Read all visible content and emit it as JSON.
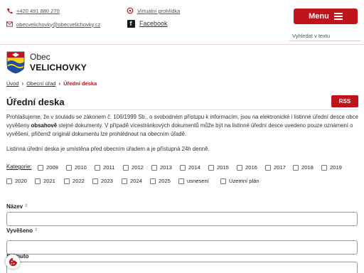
{
  "header": {
    "phone": "+420 491 880 270",
    "email": "obecvelichovky@obecvelichovky.cz",
    "virtual_tour": "Virtuální prohlídka",
    "facebook": "Facebook",
    "menu_label": "Menu",
    "search_placeholder": "Vyhledat v textu"
  },
  "logo": {
    "line1": "Obec",
    "line2": "VELICHOVKY"
  },
  "breadcrumb": {
    "items": [
      "Úvod",
      "Obecní úřad"
    ],
    "current": "Úřední deska"
  },
  "page": {
    "title": "Úřední deska",
    "rss_label": "RSS",
    "intro_part1": "Prohlašujeme, že v souladu se zákonem č. 106/1999 Sb., o svobodném přístupu k informacím, jsou na elektronické i listinné úřední desce obce vyvěšeny ",
    "intro_bold": "obsahově",
    "intro_part2": " stejné dokumenty. V případě vícestránkových dokumentů může být na listinné úřední desce uvedeno pouze oznámení o vyvěšení, přičemž originál dokumentu lze prohlédnout na obecním úřadě.",
    "intro_note": "Listinná úřední deska je umístěna před obecním úřadem a je přístupná 24h denně."
  },
  "categories": {
    "label": "Kategorie:",
    "row1": [
      "2009",
      "2010",
      "2011",
      "2012",
      "2013",
      "2014",
      "2015",
      "2016",
      "2017",
      "2018",
      "2019"
    ],
    "row2": [
      "2020",
      "2021",
      "2022",
      "2023",
      "2024",
      "2025",
      "usnesení",
      "Územní plán"
    ]
  },
  "filters": {
    "name_label": "Název",
    "posted_label": "Vyvěšeno",
    "third_label": "Sejmuto"
  },
  "colors": {
    "accent": "#c0141c"
  }
}
